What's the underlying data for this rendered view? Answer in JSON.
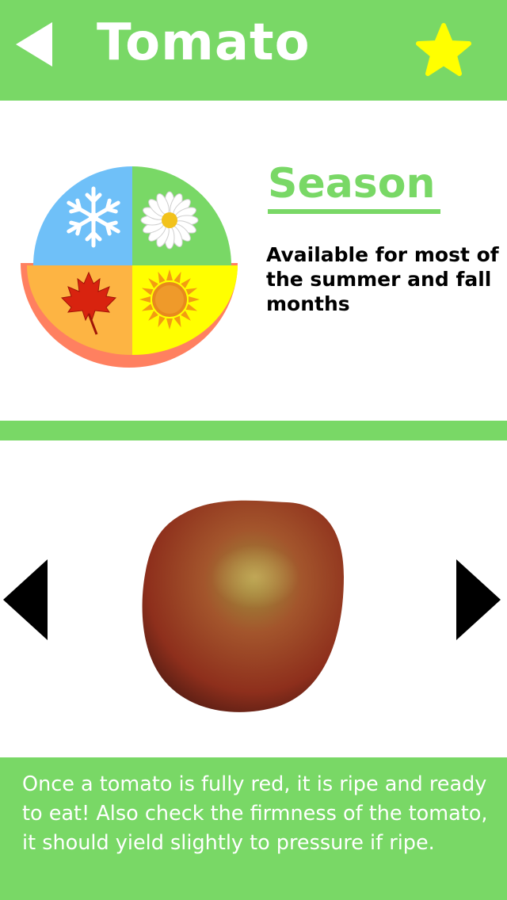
{
  "header": {
    "title": "Tomato",
    "back_icon": "back-arrow-icon",
    "favorite_icon": "star-icon"
  },
  "season": {
    "heading": "Season",
    "description": "Available for most of the summer and fall months",
    "seasons": [
      {
        "name": "winter",
        "icon": "snowflake-icon",
        "color": "#6fc0f8"
      },
      {
        "name": "spring",
        "icon": "daisy-icon",
        "color": "#79d866"
      },
      {
        "name": "fall",
        "icon": "maple-leaf-icon",
        "color": "#fdb443"
      },
      {
        "name": "summer",
        "icon": "sun-icon",
        "color": "#ffff00"
      }
    ],
    "highlight_color": "#ff8060"
  },
  "carousel": {
    "prev_icon": "left-triangle-icon",
    "next_icon": "right-triangle-icon",
    "image_icon": "tomato-image"
  },
  "tip": {
    "text": "Once a tomato is fully red, it is ripe and ready to eat! Also check the firmness of the tomato, it should yield slightly to pressure if ripe."
  },
  "colors": {
    "accent": "#79d866",
    "star": "#ffff00"
  }
}
